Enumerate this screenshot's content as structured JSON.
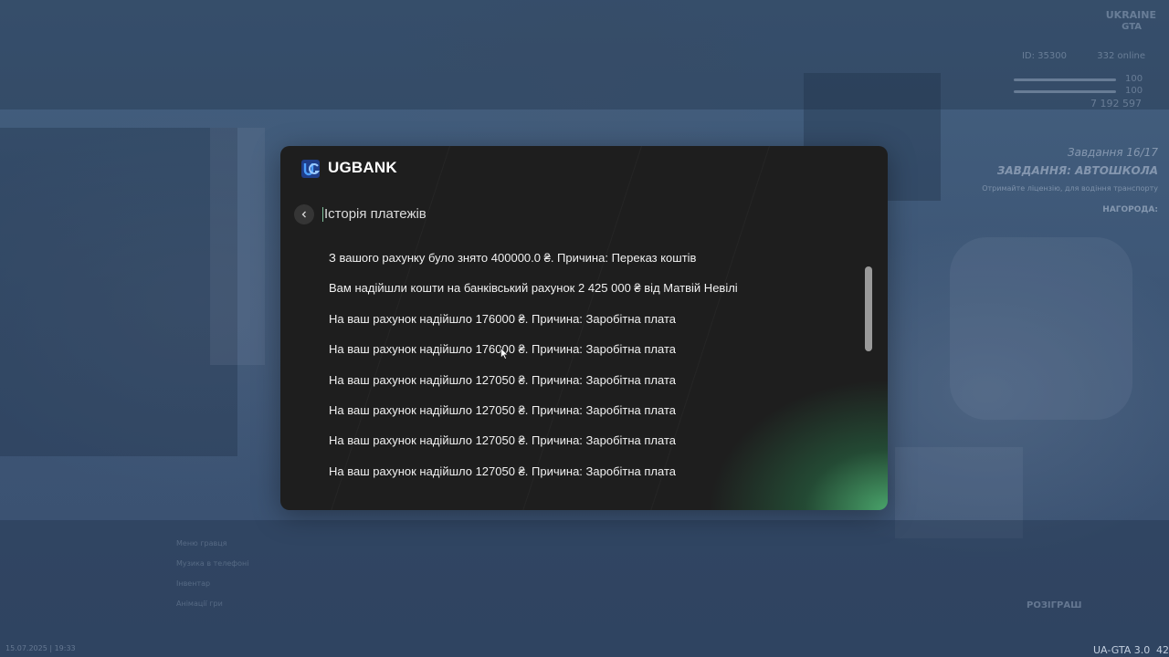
{
  "bank": {
    "brand": "UGBANK",
    "page_title": "Історія платежів",
    "transactions": [
      "З вашого рахунку було знято 400000.0 ₴. Причина: Переказ коштів",
      "Вам надійшли кошти на банківський рахунок 2 425 000 ₴ від Матвій Невілі",
      "На ваш рахунок надійшло 176000 ₴. Причина: Заробітна плата",
      "На ваш рахунок надійшло 176000 ₴. Причина: Заробітна плата",
      "На ваш рахунок надійшло 127050 ₴. Причина: Заробітна плата",
      "На ваш рахунок надійшло 127050 ₴. Причина: Заробітна плата",
      "На ваш рахунок надійшло 127050 ₴. Причина: Заробітна плата",
      "На ваш рахунок надійшло 127050 ₴. Причина: Заробітна плата"
    ]
  },
  "hud": {
    "server_name": "UKRAINE",
    "server_sub": "GTA",
    "player_id": "ID: 35300",
    "online": "332 online",
    "health": "100",
    "armor": "100",
    "money": "7 192 597",
    "quest_counter": "Завдання 16/17",
    "quest_name": "ЗАВДАННЯ: АВТОШКОЛА",
    "quest_desc": "Отримайте ліцензію, для водіння транспорту",
    "reward": "НАГОРОДА:",
    "giveaway": "РОЗІГРАШ",
    "datetime": "15.07.2025 | 19:33",
    "version": "UA-GTA 3.0",
    "fps": "42",
    "menu_hints": [
      "Меню гравця",
      "Музика в телефоні",
      "Інвентар",
      "Анімації гри"
    ]
  },
  "colors": {
    "window_bg": "#1e1e1e",
    "accent_green": "#4baa6e",
    "scene_bg": "#3b5270"
  }
}
